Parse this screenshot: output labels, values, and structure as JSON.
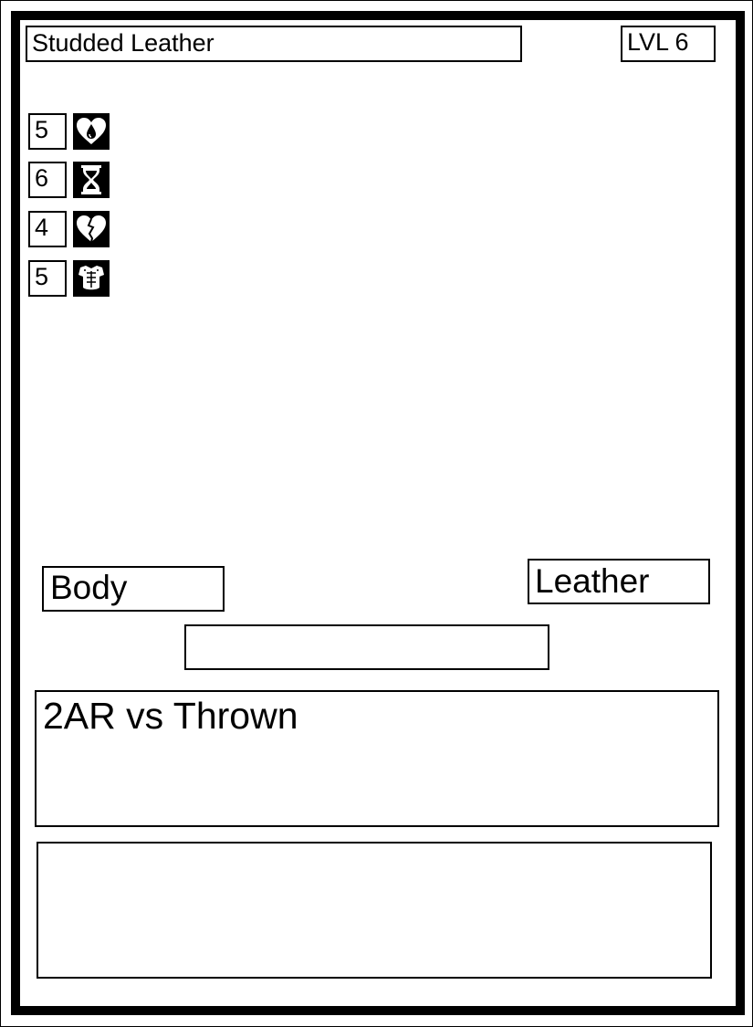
{
  "card": {
    "name": "Studded Leather",
    "level": "LVL 6",
    "stats": [
      {
        "value": "5",
        "icon": "heart-drop-icon"
      },
      {
        "value": "6",
        "icon": "hourglass-icon"
      },
      {
        "value": "4",
        "icon": "broken-heart-icon"
      },
      {
        "value": "5",
        "icon": "armor-icon"
      }
    ],
    "slot": "Body",
    "material": "Leather",
    "subtype": "",
    "ability": "2AR vs Thrown",
    "flavor": ""
  }
}
